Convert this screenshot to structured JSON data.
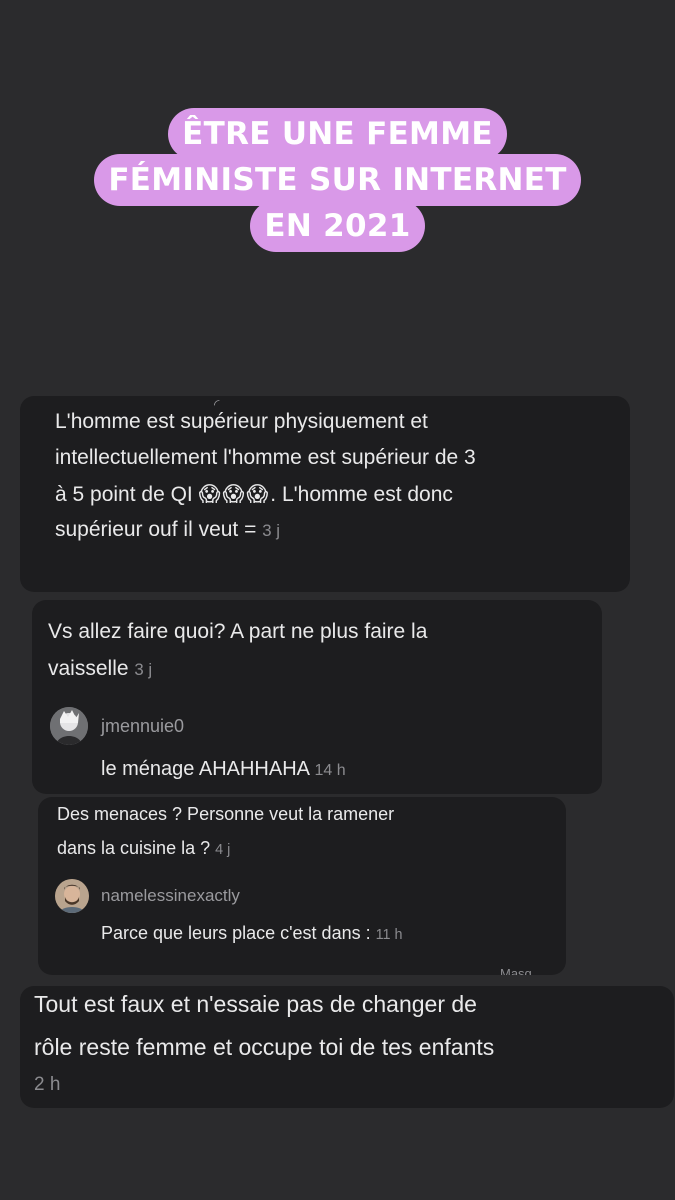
{
  "title": {
    "line1": "ÊTRE UNE FEMME",
    "line2": "FÉMINISTE SUR INTERNET",
    "line3": "EN 2021"
  },
  "comment1": {
    "line1": "L'homme est supérieur physiquement et",
    "line2": "intellectuellement l'homme est supérieur de 3",
    "line3_prefix": "à 5 point de QI",
    "emoji": "😱😱😱",
    "line3_suffix": ". L'homme est donc",
    "line4": "supérieur ouf il veut =",
    "time": "3 j"
  },
  "comment2": {
    "line1": "Vs allez faire quoi? A part ne plus faire la",
    "line2": "vaisselle",
    "time": "3 j",
    "reply": {
      "username": "jmennuie0",
      "text": "le ménage AHAHHAHA",
      "time": "14 h"
    }
  },
  "comment3": {
    "line1": "Des menaces ? Personne veut la ramener",
    "line2": "dans la cuisine la ?",
    "time": "4 j",
    "reply": {
      "username": "namelessinexactly",
      "text": "Parce que leurs place c'est dans :",
      "time": "11 h"
    },
    "cut_label": "Masq"
  },
  "comment4": {
    "line1": "Tout est faux et n'essaie pas de changer de",
    "line2": "rôle reste femme et occupe toi de tes enfants",
    "time": "2 h"
  },
  "colors": {
    "background": "#2b2b2d",
    "title_highlight": "#d999e8",
    "card": "#1d1d1f",
    "timestamp": "#8b8b8f"
  }
}
